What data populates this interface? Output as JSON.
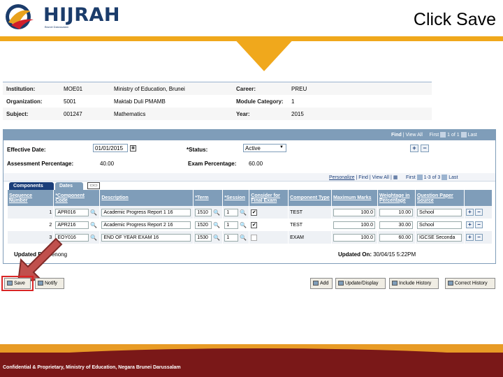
{
  "header": {
    "logo_text": "HIJRAH",
    "logo_subtitle": "Brunei Darussalam",
    "slide_title": "Click Save"
  },
  "info": {
    "institution_label": "Institution:",
    "institution_code": "MOE01",
    "institution_name": "Ministry of Education, Brunei",
    "career_label": "Career:",
    "career_value": "PREU",
    "organization_label": "Organization:",
    "organization_code": "5001",
    "organization_name": "Maktab Duli PMAMB",
    "module_category_label": "Module Category:",
    "module_category_value": "1",
    "subject_label": "Subject:",
    "subject_code": "001247",
    "subject_name": "Mathematics",
    "year_label": "Year:",
    "year_value": "2015"
  },
  "panel": {
    "nav_find": "Find",
    "nav_viewall": "View All",
    "nav_first": "First",
    "nav_count": "1 of 1",
    "nav_last": "Last",
    "effective_date_label": "Effective Date:",
    "effective_date_value": "01/01/2015",
    "status_label": "*Status:",
    "status_value": "Active",
    "assessment_pct_label": "Assessment Percentage:",
    "assessment_pct_value": "40.00",
    "exam_pct_label": "Exam Percentage:",
    "exam_pct_value": "60.00",
    "grid_personalize": "Personalize",
    "grid_find": "Find",
    "grid_viewall": "View All",
    "grid_first": "First",
    "grid_count": "1-3 of 3",
    "grid_last": "Last",
    "tab_components": "Components",
    "tab_dates": "Dates",
    "columns": [
      "Sequence Number",
      "*Component Code",
      "Description",
      "*Term",
      "*Session",
      "Consider for Final Exam",
      "Component Type",
      "Maximum Marks",
      "Weightage in Percentage",
      "Question Paper Source"
    ],
    "rows": [
      {
        "seq": "1",
        "code": "APR016",
        "desc": "Academic Progress Report 1 16",
        "term": "1510",
        "session": "1",
        "final": "✔",
        "type": "TEST",
        "max": "100.0",
        "weight": "10.00",
        "source": "School"
      },
      {
        "seq": "2",
        "code": "APR216",
        "desc": "Academic Progress Report 2 16",
        "term": "1520",
        "session": "1",
        "final": "✔",
        "type": "TEST",
        "max": "100.0",
        "weight": "30.00",
        "source": "School"
      },
      {
        "seq": "3",
        "code": "EOY016",
        "desc": "END OF YEAR EXAM 16",
        "term": "1530",
        "session": "1",
        "final": "",
        "type": "EXAM",
        "max": "100.0",
        "weight": "60.00",
        "source": "IGCSE Seconda"
      }
    ],
    "updated_by_label": "Updated By:",
    "updated_by_value": "benong",
    "updated_on_label": "Updated On:",
    "updated_on_value": "30/04/15  5:22PM"
  },
  "toolbar": {
    "save": "Save",
    "notify": "Notify",
    "add": "Add",
    "update_display": "Update/Display",
    "include_history": "Include History",
    "correct_history": "Correct History"
  },
  "footer": {
    "text": "Confidential & Proprietary, Ministry of Education, Negara Brunei Darussalam"
  },
  "colors": {
    "accent_orange": "#f0a81c",
    "footer_maroon": "#7a1818",
    "grid_header": "#7f9db9",
    "highlight_red": "#d92525"
  }
}
